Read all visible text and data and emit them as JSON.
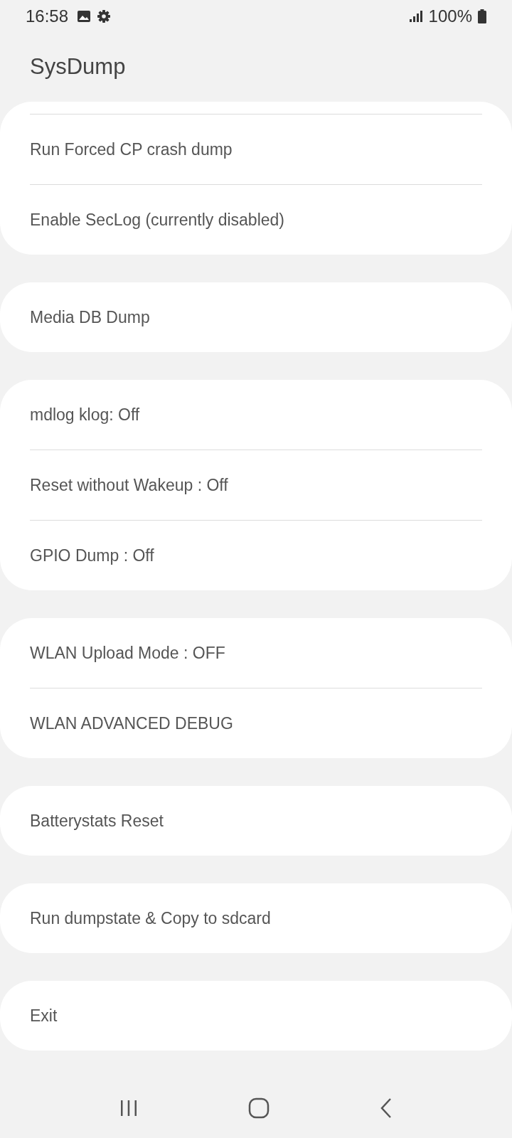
{
  "status_bar": {
    "time": "16:58",
    "battery": "100%"
  },
  "app_bar": {
    "title": "SysDump"
  },
  "groups": [
    {
      "clipped_top": true,
      "items": [
        "Run Forced CP crash dump",
        "Enable SecLog (currently disabled)"
      ]
    },
    {
      "clipped_top": false,
      "items": [
        "Media DB Dump"
      ]
    },
    {
      "clipped_top": false,
      "items": [
        "mdlog klog: Off",
        "Reset without Wakeup : Off",
        "GPIO Dump : Off"
      ]
    },
    {
      "clipped_top": false,
      "items": [
        "WLAN Upload Mode : OFF",
        "WLAN ADVANCED DEBUG"
      ]
    },
    {
      "clipped_top": false,
      "items": [
        "Batterystats Reset"
      ]
    },
    {
      "clipped_top": false,
      "items": [
        "Run dumpstate & Copy to sdcard"
      ]
    },
    {
      "clipped_top": false,
      "items": [
        "Exit"
      ]
    }
  ]
}
